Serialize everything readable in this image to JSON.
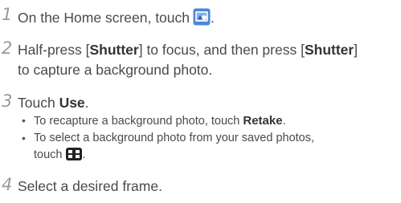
{
  "steps": [
    {
      "number": "1",
      "text_before": "On the Home screen, touch",
      "icon": "background-capture-app-icon",
      "text_after": "."
    },
    {
      "number": "2",
      "line1": {
        "a": "Half-press [",
        "b": "Shutter",
        "c": "] to focus, and then press [",
        "d": "Shutter",
        "e": "]"
      },
      "line2": "to capture a background photo."
    },
    {
      "number": "3",
      "text_before": "Touch ",
      "bold": "Use",
      "text_after": ".",
      "bullets": [
        {
          "text_before": "To recapture a background photo, touch ",
          "bold": "Retake",
          "text_after": "."
        },
        {
          "line1": "To select a background photo from your saved photos,",
          "line2_before": "touch",
          "icon": "gallery-grid-icon",
          "line2_after": "."
        }
      ]
    },
    {
      "number": "4",
      "text": "Select a desired frame."
    }
  ],
  "colors": {
    "step_number": "#9a9a9a",
    "body_text": "#4a4a4a",
    "app_icon": "#4a88d8",
    "gallery_icon": "#222222"
  }
}
